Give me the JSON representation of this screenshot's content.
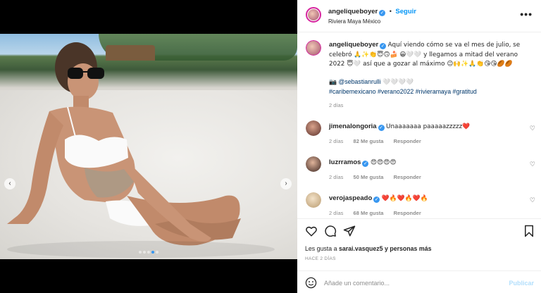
{
  "post": {
    "username": "angeliqueboyer",
    "follow_label": "Seguir",
    "location": "Riviera Maya México",
    "more_label": "•••",
    "carousel_dots": 5,
    "carousel_active": 3
  },
  "caption": {
    "username": "angeliqueboyer",
    "line1": "Aquí viendo cómo se va el mes de julio, se",
    "line2": "celebró 🙏✨👏😇🙃🍰 😀🤍🤍 y llegamos a mitad del verano",
    "line3": "2022 😇🤍 así que a gozar al máximo 😉🙌✨🙏👏😘😘🏉🏉",
    "photo_credit_prefix": "📷",
    "photo_credit_mention": "@sebastianrulli",
    "photo_credit_suffix": "🤍🤍🤍🤍",
    "hashtags": "#caribemexicano #verano2022 #rivieramaya #gratitud",
    "time": "2 días"
  },
  "comments": [
    {
      "username": "jimenalongoria",
      "text": "Unaaaaaaa paaaaazzzzz❤️",
      "time": "2 días",
      "likes": "82 Me gusta",
      "reply": "Responder"
    },
    {
      "username": "luzrramos",
      "text": "😍😍😍😍",
      "time": "2 días",
      "likes": "50 Me gusta",
      "reply": "Responder"
    },
    {
      "username": "verojaspeado",
      "text": "❤️🔥❤️🔥❤️🔥",
      "time": "2 días",
      "likes": "68 Me gusta",
      "reply": "Responder"
    }
  ],
  "likes": {
    "prefix": "Les gusta a ",
    "user": "sarai.vasquez5",
    "suffix": " y personas más"
  },
  "timestamp": "HACE 2 DÍAS",
  "add_comment": {
    "placeholder": "Añade un comentario...",
    "publish": "Publicar"
  },
  "colors": {
    "link_blue": "#0095f6",
    "hashtag": "#00376b",
    "muted": "#8e8e8e",
    "heart_red": "#ed4956"
  },
  "icons": {
    "like": "heart-icon",
    "comment": "comment-icon",
    "share": "share-icon",
    "save": "bookmark-icon",
    "emoji": "smiley-icon"
  }
}
